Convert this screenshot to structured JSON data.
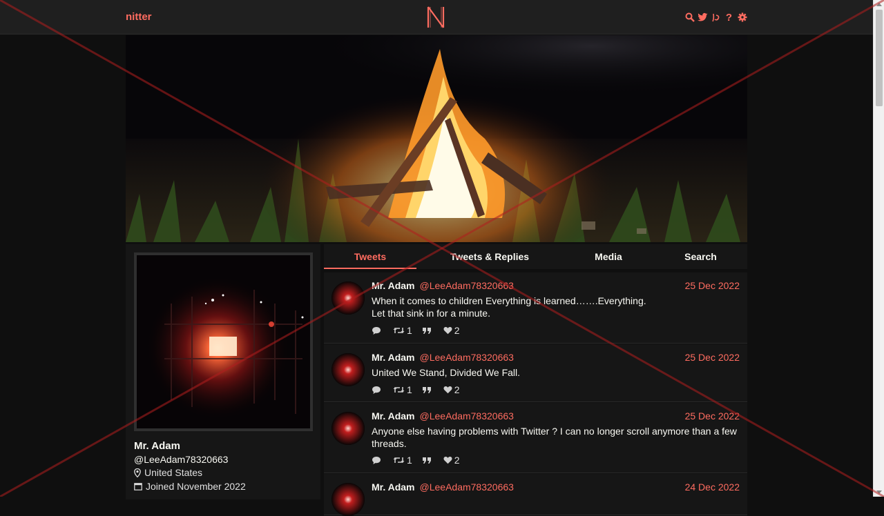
{
  "nav": {
    "brand": "nitter",
    "icons": [
      "search-icon",
      "twitter-bird-icon",
      "rss-icon",
      "help-icon",
      "settings-gear-icon"
    ]
  },
  "colors": {
    "accent": "#ff6c60",
    "bg": "#0f0f0f",
    "panel": "#161616",
    "nav": "#1f1f1f"
  },
  "profile": {
    "name": "Mr. Adam",
    "handle": "@LeeAdam78320663",
    "location": "United States",
    "joined": "Joined November 2022"
  },
  "tabs": [
    "Tweets",
    "Tweets & Replies",
    "Media",
    "Search"
  ],
  "tweets": [
    {
      "fullname": "Mr. Adam",
      "username": "@LeeAdam78320663",
      "date": "25 Dec 2022",
      "lines": [
        "When it comes to children Everything is learned…….Everything.",
        "Let that sink in for a minute."
      ],
      "stats": {
        "comments": "",
        "retweets": "1",
        "quotes": "",
        "likes": "2"
      }
    },
    {
      "fullname": "Mr. Adam",
      "username": "@LeeAdam78320663",
      "date": "25 Dec 2022",
      "lines": [
        "United We Stand, Divided We Fall."
      ],
      "stats": {
        "comments": "",
        "retweets": "1",
        "quotes": "",
        "likes": "2"
      }
    },
    {
      "fullname": "Mr. Adam",
      "username": "@LeeAdam78320663",
      "date": "25 Dec 2022",
      "lines": [
        "Anyone else having problems with Twitter ? I can no longer scroll anymore than a few threads."
      ],
      "stats": {
        "comments": "",
        "retweets": "1",
        "quotes": "",
        "likes": "2"
      }
    },
    {
      "fullname": "Mr. Adam",
      "username": "@LeeAdam78320663",
      "date": "24 Dec 2022",
      "lines": [],
      "stats": {
        "comments": "",
        "retweets": "",
        "quotes": "",
        "likes": ""
      }
    }
  ]
}
